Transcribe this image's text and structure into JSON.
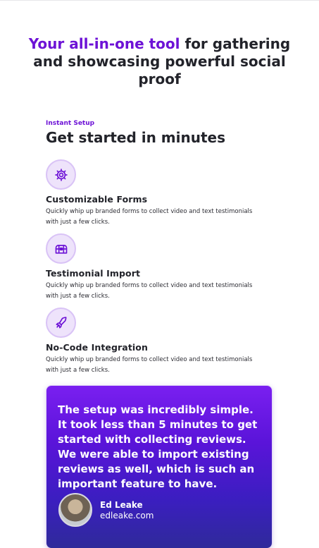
{
  "hero": {
    "title_accent": "Your all-in-one tool",
    "title_rest": " for gathering and showcasing powerful social proof"
  },
  "setup": {
    "eyebrow": "Instant Setup",
    "title": "Get started in minutes"
  },
  "features": [
    {
      "icon": "gear-icon",
      "title": "Customizable Forms",
      "description": "Quickly whip up branded forms to collect video and text testimonials with just a few clicks."
    },
    {
      "icon": "treasure-chest-icon",
      "title": "Testimonial Import",
      "description": "Quickly whip up branded forms to collect video and text testimonials with just a few clicks."
    },
    {
      "icon": "rocket-icon",
      "title": "No-Code Integration",
      "description": "Quickly whip up branded forms to collect video and text testimonials with just a few clicks."
    }
  ],
  "testimonial": {
    "quote": "The setup was incredibly simple. It took less than 5 minutes to get started with collecting reviews. We were able to import existing reviews as well, which is such an important feature to have.",
    "author_name": "Ed Leake",
    "author_site": "edleake.com"
  },
  "colors": {
    "accent": "#6d12d6",
    "icon_bg": "#eee3fb",
    "card_gradient_top": "#7a1ff0",
    "card_gradient_bottom": "#2f2a9a"
  }
}
